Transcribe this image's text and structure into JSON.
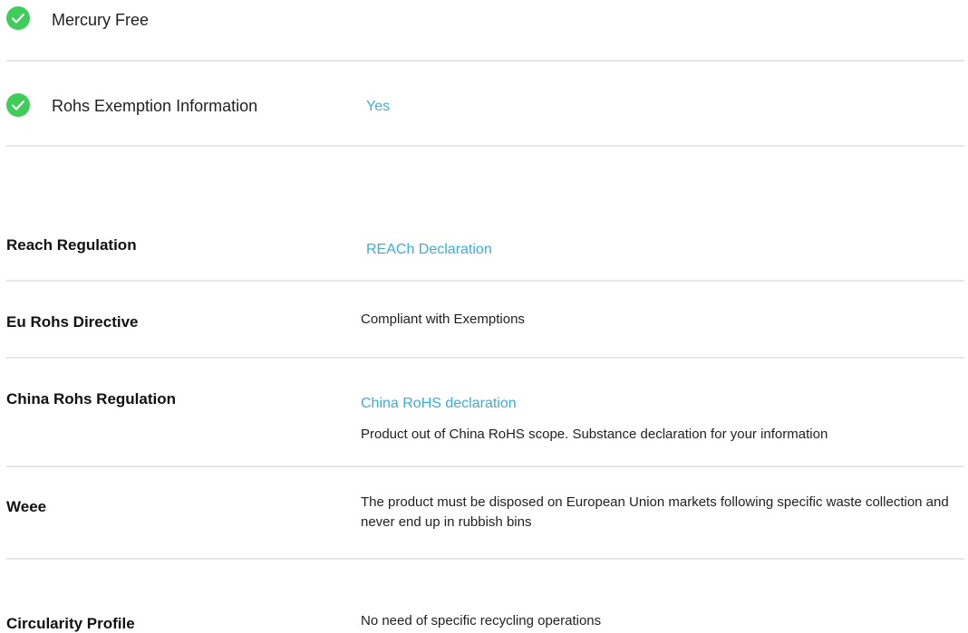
{
  "colors": {
    "check_green": "#3dcd58",
    "link_blue": "#3aaed8",
    "divider": "#e6e6e6"
  },
  "checks": [
    {
      "icon": "check-circle-icon",
      "label": "Mercury Free",
      "value": ""
    },
    {
      "icon": "check-circle-icon",
      "label": "Rohs Exemption Information",
      "value": "Yes"
    }
  ],
  "regulations": {
    "reach": {
      "label": "Reach Regulation",
      "link": "REACh Declaration"
    },
    "eu_rohs": {
      "label": "Eu Rohs Directive",
      "value": "Compliant with Exemptions"
    },
    "china_rohs": {
      "label": "China Rohs Regulation",
      "link": "China RoHS declaration",
      "value": "Product out of China RoHS scope. Substance declaration for your information"
    },
    "weee": {
      "label": "Weee",
      "value": "The product must be disposed on European Union markets following specific waste collection and never end up in rubbish bins"
    },
    "circularity": {
      "label": "Circularity Profile",
      "value": "No need of specific recycling operations"
    }
  }
}
